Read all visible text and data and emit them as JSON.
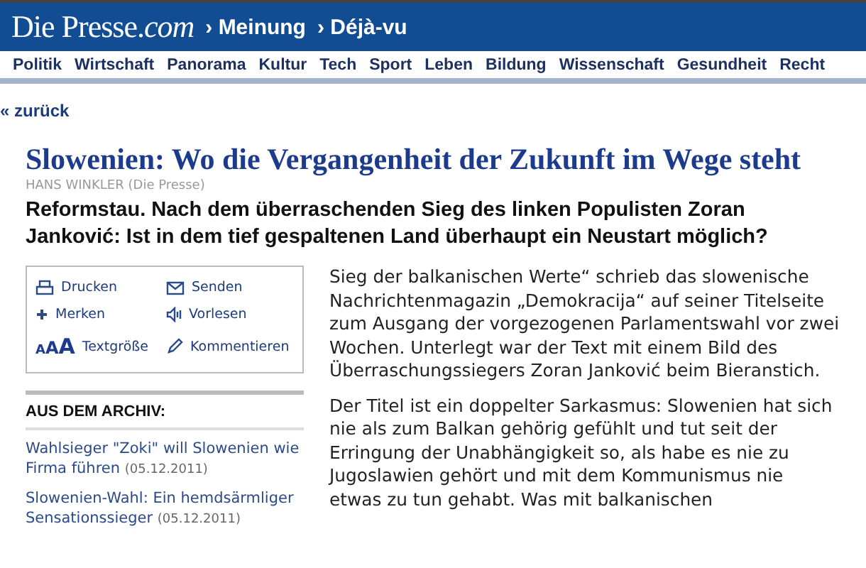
{
  "header": {
    "logo_main": "Die Presse.",
    "logo_suffix": "com",
    "breadcrumbs": [
      "Meinung",
      "Déjà-vu"
    ],
    "separator": "›"
  },
  "nav": [
    "Politik",
    "Wirtschaft",
    "Panorama",
    "Kultur",
    "Tech",
    "Sport",
    "Leben",
    "Bildung",
    "Wissenschaft",
    "Gesundheit",
    "Recht"
  ],
  "back_link": "« zurück",
  "article": {
    "title": "Slowenien: Wo die Vergangenheit der Zukunft im Wege steht",
    "author": "HANS WINKLER",
    "source": "(Die Presse)",
    "lede": "Reformstau. Nach dem überraschenden Sieg des linken Populisten Zoran Janković: Ist in dem tief gespaltenen Land überhaupt ein Neustart möglich?",
    "paragraphs": [
      "Sieg der balkanischen Werte“ schrieb das slowenische Nachrichtenmagazin „Demokracija“ auf seiner Titelseite zum Ausgang der vorgezogenen Parlamentswahl vor zwei Wochen. Unterlegt war der Text mit einem Bild des Überraschungssiegers Zoran Janković beim Bieranstich.",
      "Der Titel ist ein doppelter Sarkasmus: Slowenien hat sich nie als zum Balkan gehörig gefühlt und tut seit der Erringung der Unabhängigkeit so, als habe es nie zu Jugoslawien gehört und mit dem Kommunismus nie etwas zu tun gehabt. Was mit balkanischen"
    ]
  },
  "tools": [
    {
      "kind": "print",
      "label": "Drucken"
    },
    {
      "kind": "mail",
      "label": "Senden"
    },
    {
      "kind": "plus",
      "label": "Merken"
    },
    {
      "kind": "speaker",
      "label": "Vorlesen"
    },
    {
      "kind": "textsize",
      "label": "Textgröße",
      "icon_text": "AAA"
    },
    {
      "kind": "pencil",
      "label": "Kommentieren"
    }
  ],
  "archive": {
    "heading": "AUS DEM ARCHIV:",
    "items": [
      {
        "title": "Wahlsieger \"Zoki\" will Slowenien wie Firma führen",
        "date": "(05.12.2011)"
      },
      {
        "title": "Slowenien-Wahl: Ein hemdsärmliger Sensationssieger",
        "date": "(05.12.2011)"
      }
    ]
  }
}
